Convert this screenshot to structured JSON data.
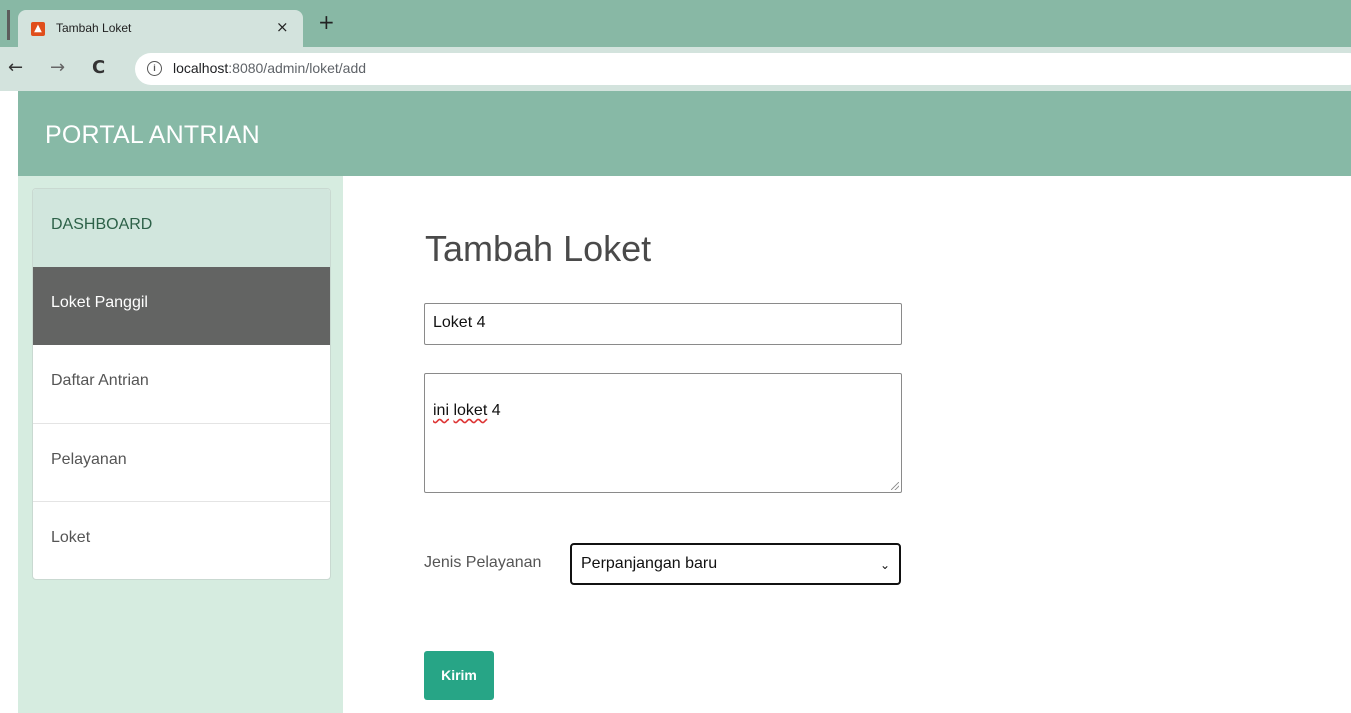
{
  "browser": {
    "tab_title": "Tambah Loket",
    "tab_close": "×",
    "new_tab": "+",
    "favicon": "fire-icon",
    "nav": {
      "back": "←",
      "forward": "→",
      "reload": "C"
    },
    "url_host": "localhost",
    "url_path": ":8080/admin/loket/add"
  },
  "header": {
    "brand": "PORTAL ANTRIAN",
    "color": "#87b9a6"
  },
  "sidebar": {
    "items": [
      {
        "label": "DASHBOARD"
      },
      {
        "label": "Loket Panggil"
      },
      {
        "label": "Daftar Antrian"
      },
      {
        "label": "Pelayanan"
      },
      {
        "label": "Loket"
      }
    ],
    "active_index": 1
  },
  "form": {
    "title": "Tambah Loket",
    "name_value": "Loket 4",
    "desc_word1": "ini",
    "desc_word2": "loket",
    "desc_rest": " 4",
    "select_label": "Jenis Pelayanan",
    "select_value": "Perpanjangan baru",
    "submit_label": "Kirim",
    "submit_color": "#27a586"
  }
}
